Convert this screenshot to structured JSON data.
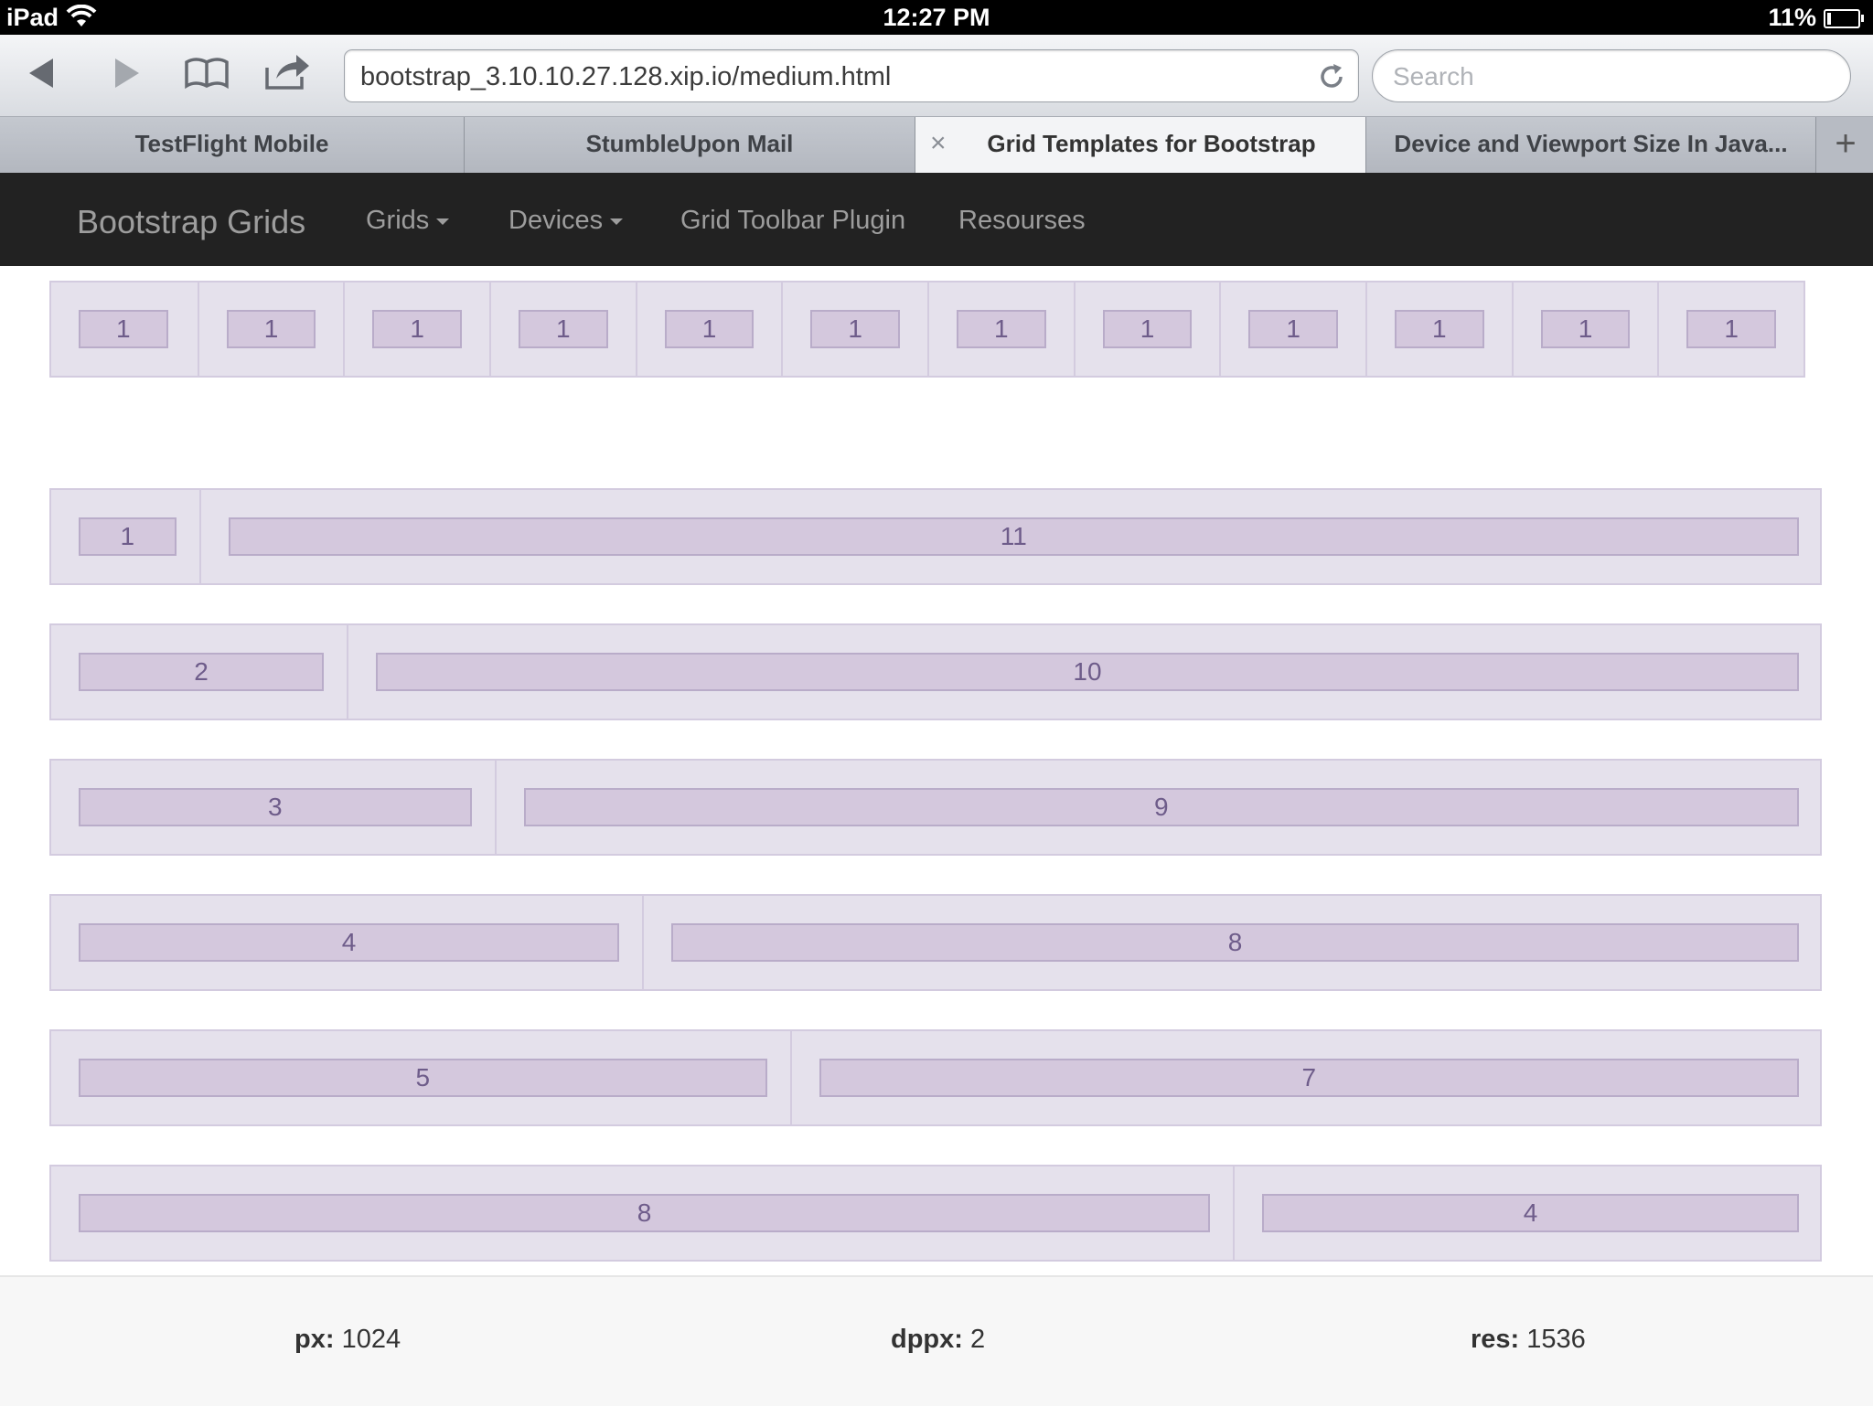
{
  "status_bar": {
    "device": "iPad",
    "time": "12:27 PM",
    "battery": "11%",
    "battery_level": 0.11
  },
  "browser": {
    "url": "bootstrap_3.10.10.27.128.xip.io/medium.html",
    "search_placeholder": "Search",
    "tabs": [
      {
        "label": "TestFlight Mobile",
        "active": false
      },
      {
        "label": "StumbleUpon Mail",
        "active": false
      },
      {
        "label": "Grid Templates for Bootstrap",
        "active": true
      },
      {
        "label": "Device and Viewport Size In Java...",
        "active": false
      }
    ],
    "close_glyph": "×",
    "add_glyph": "+"
  },
  "navbar": {
    "brand": "Bootstrap Grids",
    "items": [
      {
        "label": "Grids",
        "dropdown": true
      },
      {
        "label": "Devices",
        "dropdown": true
      },
      {
        "label": "Grid Toolbar Plugin",
        "dropdown": false
      },
      {
        "label": "Resourses",
        "dropdown": false
      }
    ]
  },
  "grid_rows": [
    [
      "1",
      "1",
      "1",
      "1",
      "1",
      "1",
      "1",
      "1",
      "1",
      "1",
      "1",
      "1"
    ],
    [
      "1",
      "11"
    ],
    [
      "2",
      "10"
    ],
    [
      "3",
      "9"
    ],
    [
      "4",
      "8"
    ],
    [
      "5",
      "7"
    ],
    [
      "8",
      "4"
    ]
  ],
  "footer": {
    "px_label": "px:",
    "px_value": "1024",
    "dppx_label": "dppx:",
    "dppx_value": "2",
    "res_label": "res:",
    "res_value": "1536"
  },
  "colors": {
    "navbar_bg": "#222222",
    "cell_bg": "#d4c8dd",
    "row_bg": "#e5e1ec",
    "cell_text": "#6e5c8a"
  }
}
